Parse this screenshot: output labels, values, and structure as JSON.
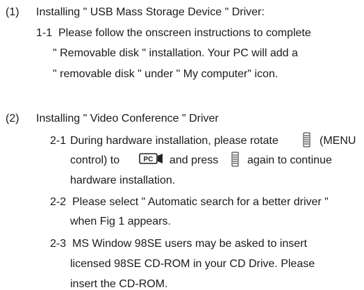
{
  "sections": [
    {
      "number": "(1)",
      "title": "Installing \" USB Mass Storage Device \" Driver:",
      "steps": [
        {
          "number": "1-1",
          "lines": [
            "Please follow the onscreen instructions to complete",
            "\" Removable disk \" installation. Your PC will add a",
            "\" removable disk \" under \" My computer\" icon."
          ]
        }
      ]
    },
    {
      "number": "(2)",
      "title": "Installing \" Video Conference \" Driver",
      "steps": [
        {
          "number": "2-1",
          "line1_before_icon": "During hardware installation, please rotate",
          "line1_after_icon": "(MENU",
          "line2_before_icon": "control) to",
          "line2_middle": "and press",
          "line2_after_icon": "again to continue",
          "line3": "hardware installation.",
          "icons": [
            "menu-dial-icon",
            "pc-camera-icon",
            "menu-dial-icon"
          ]
        },
        {
          "number": "2-2",
          "lines": [
            "Please select \" Automatic search for a better driver \"",
            "when Fig 1 appears."
          ]
        },
        {
          "number": "2-3",
          "lines": [
            "MS Window 98SE users may be asked to insert",
            "licensed 98SE CD-ROM in your CD Drive. Please",
            "insert the CD-ROM."
          ]
        }
      ]
    }
  ]
}
